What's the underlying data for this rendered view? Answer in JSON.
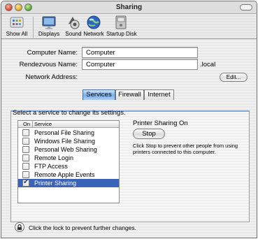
{
  "window": {
    "title": "Sharing"
  },
  "toolbar": {
    "items": [
      {
        "label": "Show All",
        "icon": "show-all-icon"
      },
      {
        "label": "Displays",
        "icon": "displays-icon"
      },
      {
        "label": "Sound",
        "icon": "sound-icon"
      },
      {
        "label": "Network",
        "icon": "network-icon"
      },
      {
        "label": "Startup Disk",
        "icon": "startup-disk-icon"
      }
    ]
  },
  "form": {
    "computer_name_label": "Computer Name:",
    "computer_name_value": "Computer",
    "rendezvous_label": "Rendezvous Name:",
    "rendezvous_value": "Computer",
    "rendezvous_suffix": ".local",
    "network_address_label": "Network Address:",
    "edit_button": "Edit..."
  },
  "tabs": [
    {
      "label": "Services",
      "active": true
    },
    {
      "label": "Firewall",
      "active": false
    },
    {
      "label": "Internet",
      "active": false
    }
  ],
  "services": {
    "instruction": "Select a service to change its settings.",
    "column_on": "On",
    "column_service": "Service",
    "items": [
      {
        "name": "Personal File Sharing",
        "checked": false,
        "selected": false
      },
      {
        "name": "Windows File Sharing",
        "checked": false,
        "selected": false
      },
      {
        "name": "Personal Web Sharing",
        "checked": false,
        "selected": false
      },
      {
        "name": "Remote Login",
        "checked": false,
        "selected": false
      },
      {
        "name": "FTP Access",
        "checked": false,
        "selected": false
      },
      {
        "name": "Remote Apple Events",
        "checked": false,
        "selected": false
      },
      {
        "name": "Printer Sharing",
        "checked": true,
        "selected": true
      }
    ],
    "check_mark": "✔",
    "status": "Printer Sharing On",
    "stop_button": "Stop",
    "description": "Click Stop to prevent other people from using printers connected to this computer."
  },
  "lock": {
    "text": "Click the lock to prevent further changes."
  },
  "colors": {
    "selection": "#3b63b8",
    "tab_active": "#7db1ea"
  }
}
